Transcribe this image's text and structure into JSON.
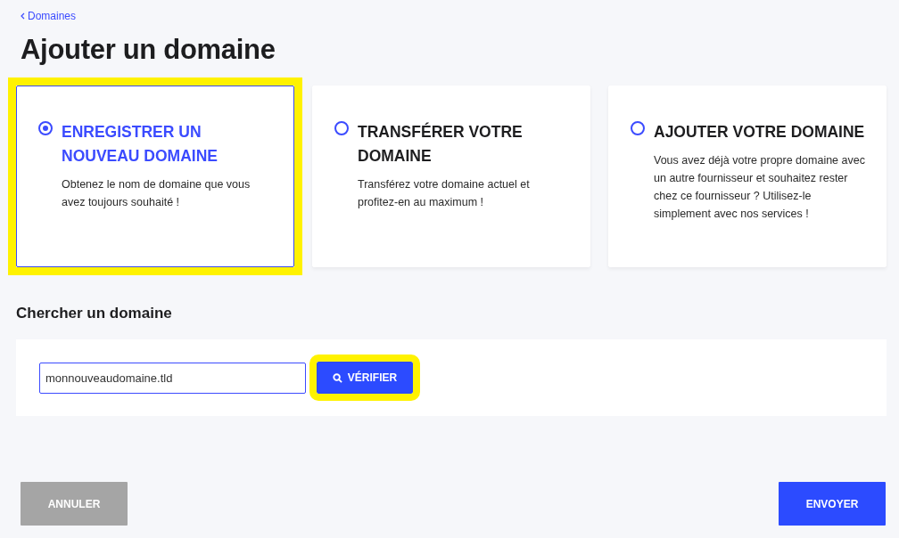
{
  "breadcrumb": {
    "label": "Domaines"
  },
  "title": "Ajouter un domaine",
  "options": [
    {
      "title": "ENREGISTRER UN NOUVEAU DOMAINE",
      "description": "Obtenez le nom de domaine que vous avez toujours souhaité !",
      "selected": true,
      "highlighted": true
    },
    {
      "title": "TRANSFÉRER VOTRE DOMAINE",
      "description": "Transférez votre domaine actuel et profitez-en au maximum !",
      "selected": false,
      "highlighted": false
    },
    {
      "title": "AJOUTER VOTRE DOMAINE",
      "description": "Vous avez déjà votre propre domaine avec un autre fournisseur et souhaitez rester chez ce fournisseur ? Utilisez-le simplement avec nos services !",
      "selected": false,
      "highlighted": false
    }
  ],
  "search": {
    "heading": "Chercher un domaine",
    "value": "monnouveaudomaine.tld",
    "button": "VÉRIFIER",
    "button_highlighted": true
  },
  "buttons": {
    "cancel": "ANNULER",
    "submit": "ENVOYER"
  }
}
